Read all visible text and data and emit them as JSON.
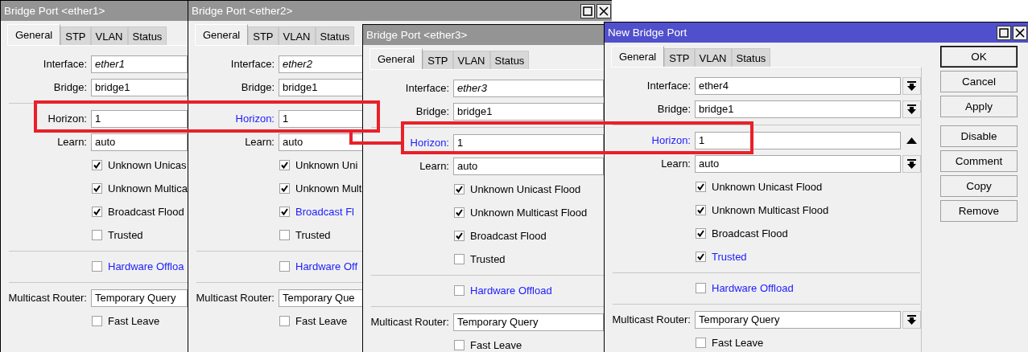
{
  "windows": [
    {
      "title": "Bridge Port <ether1>",
      "active": false,
      "title_controls": false,
      "tabs": [
        {
          "label": "General",
          "selected": true
        },
        {
          "label": "STP",
          "selected": false
        },
        {
          "label": "VLAN",
          "selected": false
        },
        {
          "label": "Status",
          "selected": false
        }
      ],
      "sections": [
        {
          "rows": [
            {
              "kind": "field",
              "label": "Interface:",
              "value": "ether1",
              "fixed": true,
              "modified": false
            },
            {
              "kind": "field",
              "label": "Bridge:",
              "value": "bridge1",
              "fixed": false,
              "modified": false
            }
          ]
        },
        {
          "rows": [
            {
              "kind": "field",
              "label": "Horizon:",
              "value": "1",
              "fixed": false,
              "modified": false
            },
            {
              "kind": "field",
              "label": "Learn:",
              "value": "auto",
              "fixed": false,
              "modified": false
            },
            {
              "kind": "checkbox",
              "label": "Unknown Unicas",
              "checked": true,
              "modified": false
            },
            {
              "kind": "checkbox",
              "label": "Unknown Multica",
              "checked": true,
              "modified": false
            },
            {
              "kind": "checkbox",
              "label": "Broadcast Flood",
              "checked": true,
              "modified": false
            },
            {
              "kind": "checkbox",
              "label": "Trusted",
              "checked": false,
              "modified": false
            }
          ]
        },
        {
          "rows": [
            {
              "kind": "checkbox",
              "label": "Hardware Offloa",
              "checked": false,
              "modified": true
            }
          ]
        },
        {
          "rows": [
            {
              "kind": "field",
              "label": "Multicast Router:",
              "value": "Temporary Query",
              "fixed": false,
              "modified": false
            },
            {
              "kind": "checkbox",
              "label": "Fast Leave",
              "checked": false,
              "modified": false
            }
          ]
        }
      ]
    },
    {
      "title": "Bridge Port <ether2>",
      "active": false,
      "title_controls": true,
      "tabs": [
        {
          "label": "General",
          "selected": true
        },
        {
          "label": "STP",
          "selected": false
        },
        {
          "label": "VLAN",
          "selected": false
        },
        {
          "label": "Status",
          "selected": false
        }
      ],
      "sections": [
        {
          "rows": [
            {
              "kind": "field",
              "label": "Interface:",
              "value": "ether2",
              "fixed": true,
              "modified": false
            },
            {
              "kind": "field",
              "label": "Bridge:",
              "value": "bridge1",
              "fixed": false,
              "modified": false
            }
          ]
        },
        {
          "rows": [
            {
              "kind": "field",
              "label": "Horizon:",
              "value": "1",
              "fixed": false,
              "modified": true
            },
            {
              "kind": "field",
              "label": "Learn:",
              "value": "auto",
              "fixed": false,
              "modified": false
            },
            {
              "kind": "checkbox",
              "label": "Unknown Uni",
              "checked": true,
              "modified": false
            },
            {
              "kind": "checkbox",
              "label": "Unknown Mult",
              "checked": true,
              "modified": false
            },
            {
              "kind": "checkbox",
              "label": "Broadcast Fl",
              "checked": true,
              "modified": true
            },
            {
              "kind": "checkbox",
              "label": "Trusted",
              "checked": false,
              "modified": false
            }
          ]
        },
        {
          "rows": [
            {
              "kind": "checkbox",
              "label": "Hardware Off",
              "checked": false,
              "modified": true
            }
          ]
        },
        {
          "rows": [
            {
              "kind": "field",
              "label": "Multicast Router:",
              "value": "Temporary Que",
              "fixed": false,
              "modified": false
            },
            {
              "kind": "checkbox",
              "label": "Fast Leave",
              "checked": false,
              "modified": false
            }
          ]
        }
      ]
    },
    {
      "title": "Bridge Port <ether3>",
      "active": false,
      "title_controls": false,
      "tabs": [
        {
          "label": "General",
          "selected": true
        },
        {
          "label": "STP",
          "selected": false
        },
        {
          "label": "VLAN",
          "selected": false
        },
        {
          "label": "Status",
          "selected": false
        }
      ],
      "sections": [
        {
          "rows": [
            {
              "kind": "field",
              "label": "Interface:",
              "value": "ether3",
              "fixed": true,
              "modified": false
            },
            {
              "kind": "field",
              "label": "Bridge:",
              "value": "bridge1",
              "fixed": false,
              "modified": false
            }
          ]
        },
        {
          "rows": [
            {
              "kind": "field",
              "label": "Horizon:",
              "value": "1",
              "fixed": false,
              "modified": true
            },
            {
              "kind": "field",
              "label": "Learn:",
              "value": "auto",
              "fixed": false,
              "modified": false
            },
            {
              "kind": "checkbox",
              "label": "Unknown Unicast Flood",
              "checked": true,
              "modified": false
            },
            {
              "kind": "checkbox",
              "label": "Unknown Multicast Flood",
              "checked": true,
              "modified": false
            },
            {
              "kind": "checkbox",
              "label": "Broadcast Flood",
              "checked": true,
              "modified": false
            },
            {
              "kind": "checkbox",
              "label": "Trusted",
              "checked": false,
              "modified": false
            }
          ]
        },
        {
          "rows": [
            {
              "kind": "checkbox",
              "label": "Hardware Offload",
              "checked": false,
              "modified": true
            }
          ]
        },
        {
          "rows": [
            {
              "kind": "field",
              "label": "Multicast Router:",
              "value": "Temporary Query",
              "fixed": false,
              "modified": false
            },
            {
              "kind": "checkbox",
              "label": "Fast Leave",
              "checked": false,
              "modified": false
            }
          ]
        }
      ]
    },
    {
      "title": "New Bridge Port",
      "active": true,
      "title_controls": true,
      "tabs": [
        {
          "label": "General",
          "selected": true
        },
        {
          "label": "STP",
          "selected": false
        },
        {
          "label": "VLAN",
          "selected": false
        },
        {
          "label": "Status",
          "selected": false
        }
      ],
      "sections": [
        {
          "rows": [
            {
              "kind": "combo",
              "label": "Interface:",
              "value": "ether4",
              "fixed": false,
              "modified": false
            },
            {
              "kind": "combo",
              "label": "Bridge:",
              "value": "bridge1",
              "fixed": false,
              "modified": false
            }
          ]
        },
        {
          "rows": [
            {
              "kind": "collapsible",
              "label": "Horizon:",
              "value": "1",
              "fixed": false,
              "modified": true
            },
            {
              "kind": "combo",
              "label": "Learn:",
              "value": "auto",
              "fixed": false,
              "modified": false
            },
            {
              "kind": "checkbox",
              "label": "Unknown Unicast Flood",
              "checked": true,
              "modified": false
            },
            {
              "kind": "checkbox",
              "label": "Unknown Multicast Flood",
              "checked": true,
              "modified": false
            },
            {
              "kind": "checkbox",
              "label": "Broadcast Flood",
              "checked": true,
              "modified": false
            },
            {
              "kind": "checkbox",
              "label": "Trusted",
              "checked": true,
              "modified": true
            }
          ]
        },
        {
          "rows": [
            {
              "kind": "checkbox",
              "label": "Hardware Offload",
              "checked": false,
              "modified": true
            }
          ]
        },
        {
          "rows": [
            {
              "kind": "combo",
              "label": "Multicast Router:",
              "value": "Temporary Query",
              "fixed": false,
              "modified": false
            },
            {
              "kind": "checkbox",
              "label": "Fast Leave",
              "checked": false,
              "modified": false
            }
          ]
        }
      ],
      "button_groups": [
        [
          {
            "label": "OK",
            "default": true
          },
          {
            "label": "Cancel",
            "default": false
          },
          {
            "label": "Apply",
            "default": false
          }
        ],
        [
          {
            "label": "Disable",
            "default": false
          },
          {
            "label": "Comment",
            "default": false
          },
          {
            "label": "Copy",
            "default": false
          },
          {
            "label": "Remove",
            "default": false
          }
        ]
      ]
    }
  ]
}
